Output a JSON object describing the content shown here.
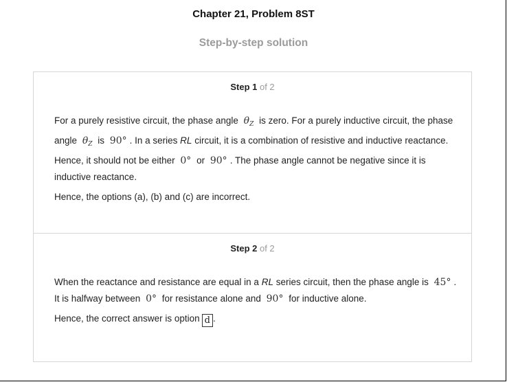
{
  "header": {
    "chapter_title": "Chapter 21, Problem 8ST",
    "subtitle": "Step-by-step solution"
  },
  "steps": [
    {
      "label": "Step 1",
      "of": " of 2",
      "p1": {
        "t1": "For a purely resistive circuit, the phase angle",
        "m1_sym": "θ",
        "m1_sub": "Z",
        "t2": "is zero. For a purely inductive circuit, the phase angle",
        "m2_sym": "θ",
        "m2_sub": "Z",
        "t3": "is",
        "m3": "90°",
        "t4": ". In a series",
        "rl": "RL",
        "t5": "circuit, it is a combination of resistive and inductive reactance. Hence, it should not be either",
        "m4": "0°",
        "t6": "or",
        "m5": "90°",
        "t7": ". The phase angle cannot be negative since it is inductive reactance."
      },
      "p2": "Hence, the options (a), (b) and (c) are incorrect."
    },
    {
      "label": "Step 2",
      "of": " of 2",
      "p1": {
        "t1": "When the reactance and resistance are equal in a",
        "rl": "RL",
        "t2": "series circuit, then the phase angle is",
        "m1": "45°",
        "t3": ". It is halfway between",
        "m2": "0°",
        "t4": "for resistance alone and",
        "m3": "90°",
        "t5": "for inductive alone."
      },
      "p2": {
        "t1": "Hence, the correct answer is option",
        "answer": "d",
        "t2": "."
      }
    }
  ]
}
